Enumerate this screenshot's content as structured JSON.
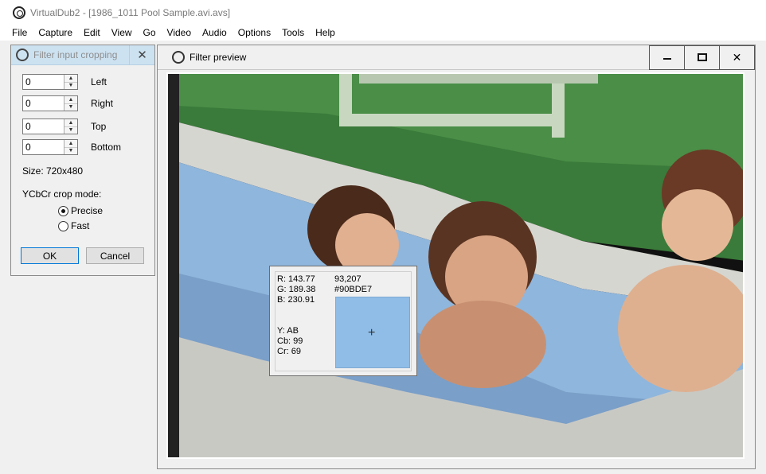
{
  "app": {
    "title": "VirtualDub2 - [1986_1011 Pool Sample.avi.avs]"
  },
  "menu": [
    "File",
    "Capture",
    "Edit",
    "View",
    "Go",
    "Video",
    "Audio",
    "Options",
    "Tools",
    "Help"
  ],
  "crop_dialog": {
    "title": "Filter input cropping",
    "close": "✕",
    "fields": [
      {
        "value": "0",
        "label": "Left"
      },
      {
        "value": "0",
        "label": "Right"
      },
      {
        "value": "0",
        "label": "Top"
      },
      {
        "value": "0",
        "label": "Bottom"
      }
    ],
    "size": "Size: 720x480",
    "mode_label": "YCbCr crop mode:",
    "options": [
      "Precise",
      "Fast"
    ],
    "selected": "Precise",
    "ok": "OK",
    "cancel": "Cancel"
  },
  "preview": {
    "title": "Filter preview",
    "close": "✕"
  },
  "pixel_info": {
    "r": "R: 143.77",
    "g": "G: 189.38",
    "b": "B: 230.91",
    "coords": "93,207",
    "hex": "#90BDE7",
    "y": "Y: AB",
    "cb": "Cb: 99",
    "cr": "Cr: 69",
    "swatch_color": "#90BDE7"
  }
}
